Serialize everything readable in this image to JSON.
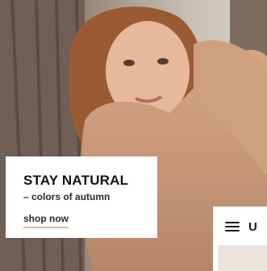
{
  "hero": {
    "image": "woman-in-knit-sweater-by-tree",
    "colors": {
      "bark": "#6b5a4e",
      "sweater": "#c89a78",
      "hair": "#9a5b34",
      "skin": "#e8b89d"
    }
  },
  "promo": {
    "title": "STAY NATURAL",
    "subtitle": "– colors of autumn",
    "link": "shop now",
    "link_underline": "#d9b9a6"
  },
  "side_panel": {
    "menu_icon": "hamburger-menu-icon",
    "label": "U"
  }
}
